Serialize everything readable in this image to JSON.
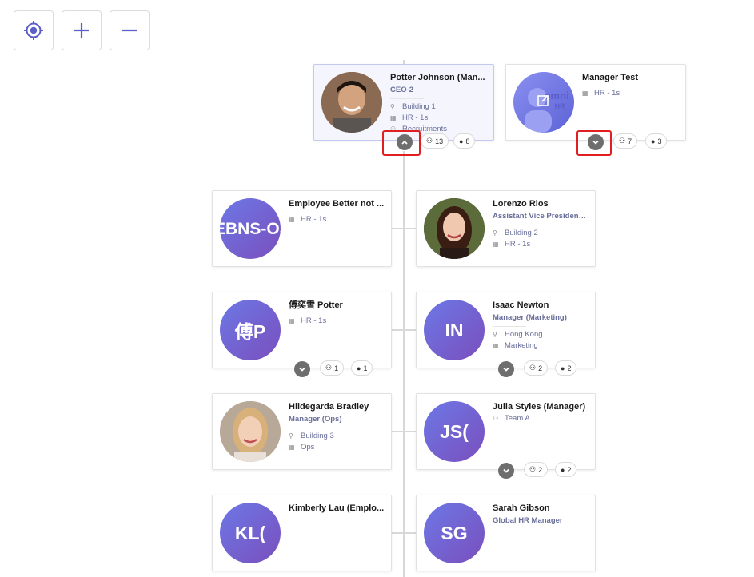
{
  "controls": {
    "locate": "locate-icon",
    "zoom_in": "plus-icon",
    "zoom_out": "minus-icon"
  },
  "top_cards": [
    {
      "name": "Potter Johnson (Man...",
      "title": "CEO-2",
      "details": [
        "Building 1",
        "HR - 1s",
        "Recruitments"
      ],
      "team_count": "13",
      "direct_count": "8",
      "expanded": true
    },
    {
      "name": "Manager Test",
      "details": [
        "HR - 1s"
      ],
      "team_count": "7",
      "direct_count": "3",
      "avatar_logo": "omni HR"
    }
  ],
  "employees": [
    {
      "name": "Employee Better not ...",
      "initials": "EBNS-OS",
      "details": [
        "HR - 1s"
      ]
    },
    {
      "name": "Lorenzo Rios",
      "title": "Assistant Vice President ...",
      "details": [
        "Building 2",
        "HR - 1s"
      ]
    },
    {
      "name": "傅奕雪 Potter",
      "initials": "傅P",
      "details": [
        "HR - 1s"
      ],
      "team_count": "1",
      "direct_count": "1"
    },
    {
      "name": "Isaac Newton",
      "initials": "IN",
      "title": "Manager (Marketing)",
      "details": [
        "Hong Kong",
        "Marketing"
      ],
      "team_count": "2",
      "direct_count": "2"
    },
    {
      "name": "Hildegarda Bradley",
      "title": "Manager (Ops)",
      "details": [
        "Building 3",
        "Ops"
      ]
    },
    {
      "name": "Julia Styles (Manager)",
      "initials": "JS(",
      "details": [
        "Team A"
      ],
      "team_count": "2",
      "direct_count": "2"
    },
    {
      "name": "Kimberly Lau (Emplo...",
      "initials": "KL("
    },
    {
      "name": "Sarah Gibson",
      "initials": "SG",
      "title": "Global HR Manager"
    }
  ],
  "colors": {
    "accent": "#5b5fc7",
    "avatar_gradient_start": "#6c78e6",
    "avatar_gradient_end": "#7a4fbd",
    "highlight": "#e02020"
  }
}
